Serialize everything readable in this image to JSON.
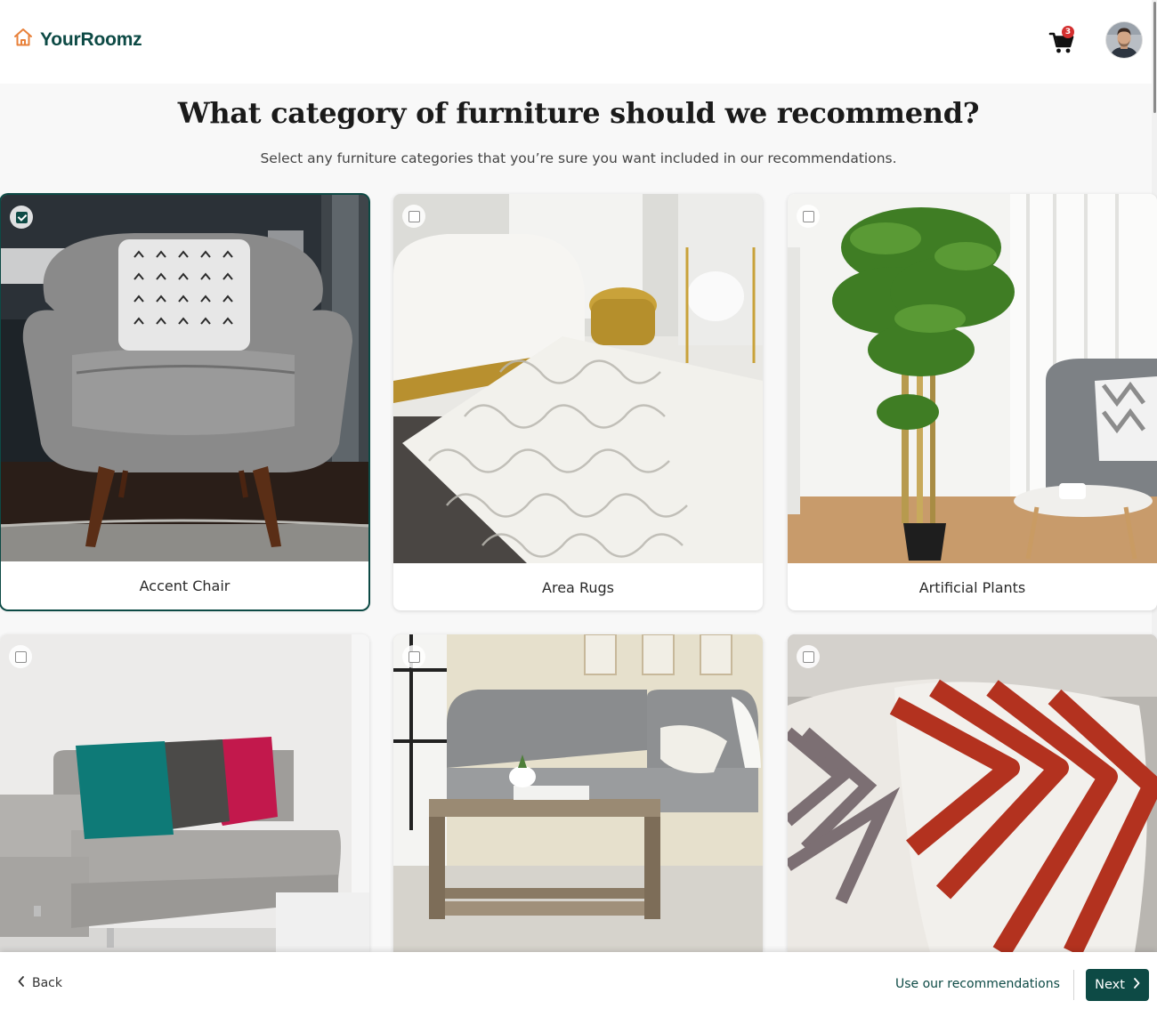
{
  "brand": {
    "name": "YourRoomz",
    "logo_icon": "house-icon",
    "accent": "#e8813a",
    "primary": "#0d4a45"
  },
  "header": {
    "cart_icon": "shopping-cart-icon",
    "cart_count": "3",
    "cart_badge_color": "#d32f2f",
    "avatar_icon": "user-avatar"
  },
  "page": {
    "title": "What category of furniture should we recommend?",
    "subtitle": "Select any furniture categories that you’re sure you want included in our recommendations."
  },
  "categories": [
    {
      "label": "Accent Chair",
      "selected": true
    },
    {
      "label": "Area Rugs",
      "selected": false
    },
    {
      "label": "Artificial Plants",
      "selected": false
    },
    {
      "label": "",
      "selected": false
    },
    {
      "label": "",
      "selected": false
    },
    {
      "label": "",
      "selected": false
    }
  ],
  "footer": {
    "back_label": "Back",
    "use_recommendations_label": "Use our recommendations",
    "next_label": "Next",
    "next_color": "#0d4a45"
  }
}
